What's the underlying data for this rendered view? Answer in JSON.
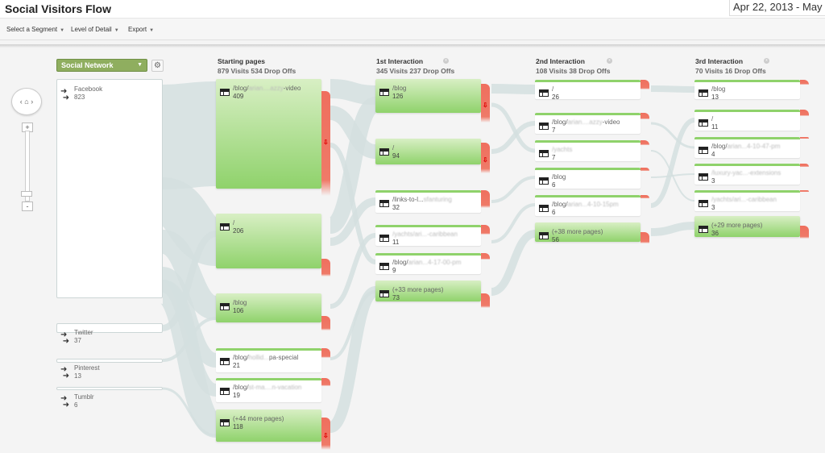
{
  "header": {
    "title": "Social Visitors Flow",
    "date_range": "Apr 22, 2013 - May"
  },
  "toolbar": {
    "items": [
      {
        "label": "Select a Segment"
      },
      {
        "label": "Level of Detail"
      },
      {
        "label": "Export"
      }
    ],
    "caret": "▼"
  },
  "navigation": {
    "pan_left": "‹",
    "home_icon": "⌂",
    "pan_right": "›",
    "zoom_in": "+",
    "zoom_out": "-"
  },
  "dimension": {
    "selected": "Social Network",
    "caret": "▼",
    "settings_icon": "⚙"
  },
  "sources": [
    {
      "name": "Facebook",
      "visits": "823"
    },
    {
      "name": "Twitter",
      "visits": "37"
    },
    {
      "name": "Pinterest",
      "visits": "13"
    },
    {
      "name": "Tumblr",
      "visits": "6"
    }
  ],
  "columns": [
    {
      "title": "Starting pages",
      "summary": "879 Visits 534 Drop Offs",
      "nodes": [
        {
          "prefix": "/blog/",
          "blurred": "arian....azzy",
          "suffix": "-video",
          "visits": "409"
        },
        {
          "prefix": "/",
          "blurred": "",
          "suffix": "",
          "visits": "206"
        },
        {
          "prefix": "/blog",
          "blurred": "",
          "suffix": "",
          "visits": "106"
        },
        {
          "prefix": "/blog/",
          "blurred": "hollid...",
          "suffix": "pa-special",
          "visits": "21"
        },
        {
          "prefix": "/blog/",
          "blurred": "st-ma....n-vacation",
          "suffix": "",
          "visits": "19"
        },
        {
          "prefix": "(+44 more pages)",
          "blurred": "",
          "suffix": "",
          "visits": "118"
        }
      ]
    },
    {
      "title": "1st Interaction",
      "summary": "345 Visits 237 Drop Offs",
      "nodes": [
        {
          "prefix": "/blog",
          "blurred": "",
          "suffix": "",
          "visits": "126"
        },
        {
          "prefix": "/",
          "blurred": "",
          "suffix": "",
          "visits": "94"
        },
        {
          "prefix": "/links-to-l...",
          "blurred": "sfanturing",
          "suffix": "",
          "visits": "32"
        },
        {
          "prefix": "",
          "blurred": "/yachts/ari...-caribbean",
          "suffix": "",
          "visits": "11"
        },
        {
          "prefix": "/blog/",
          "blurred": "arian...4-17-00-pm",
          "suffix": "",
          "visits": "9"
        },
        {
          "prefix": "(+33 more pages)",
          "blurred": "",
          "suffix": "",
          "visits": "73"
        }
      ]
    },
    {
      "title": "2nd Interaction",
      "summary": "108 Visits 38 Drop Offs",
      "nodes": [
        {
          "prefix": "/",
          "blurred": "",
          "suffix": "",
          "visits": "26"
        },
        {
          "prefix": "/blog/",
          "blurred": "arian....azzy",
          "suffix": "-video",
          "visits": "7"
        },
        {
          "prefix": "",
          "blurred": "/yachts",
          "suffix": "",
          "visits": "7"
        },
        {
          "prefix": "/blog",
          "blurred": "",
          "suffix": "",
          "visits": "6"
        },
        {
          "prefix": "/blog/",
          "blurred": "arian...4-10-15pm",
          "suffix": "",
          "visits": "6"
        },
        {
          "prefix": "(+38 more pages)",
          "blurred": "",
          "suffix": "",
          "visits": "56"
        }
      ]
    },
    {
      "title": "3rd Interaction",
      "summary": "70 Visits 16 Drop Offs",
      "nodes": [
        {
          "prefix": "/blog",
          "blurred": "",
          "suffix": "",
          "visits": "13"
        },
        {
          "prefix": "/",
          "blurred": "",
          "suffix": "",
          "visits": "11"
        },
        {
          "prefix": "/blog/",
          "blurred": "arian...4-10-47-pm",
          "suffix": "",
          "visits": "4"
        },
        {
          "prefix": "",
          "blurred": "/luxury-yac...-extensions",
          "suffix": "",
          "visits": "3"
        },
        {
          "prefix": "",
          "blurred": "/yachts/ari...-caribbean",
          "suffix": "",
          "visits": "3"
        },
        {
          "prefix": "(+29 more pages)",
          "blurred": "",
          "suffix": "",
          "visits": "36"
        }
      ]
    }
  ],
  "icons": {
    "source_arrow": "source-arrow-icon",
    "page": "page-icon",
    "drop_off": "drop-off-arrow-icon",
    "remove_column": "close-icon"
  },
  "colors": {
    "node_green": "#8fd26b",
    "drop_red": "#ef6f5e",
    "flow": "#d3dfdf",
    "dimension": "#8fae5f"
  }
}
